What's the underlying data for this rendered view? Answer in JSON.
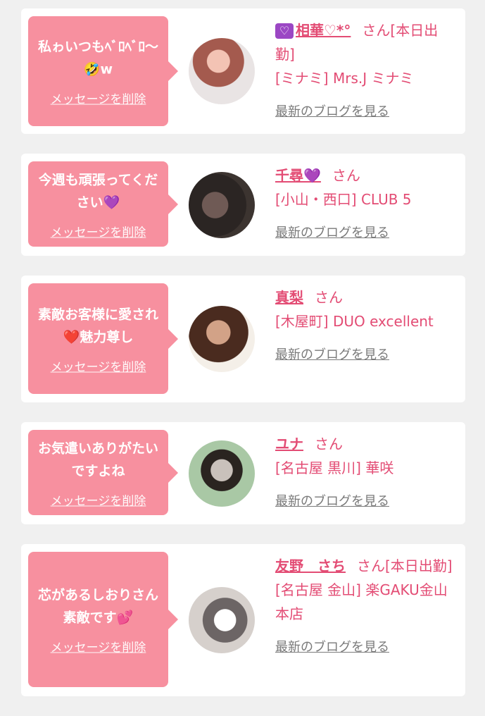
{
  "items": [
    {
      "message": "私ゎいつもﾍﾞﾛﾍﾞﾛ〜🤣w",
      "delete_label": "メッセージを削除",
      "name_prefix_icon": "♡",
      "name": "相華♡*°",
      "suffix": "さん",
      "status": "[本日出勤]",
      "shop": "[ミナミ] Mrs.J ミナミ",
      "blog_label": "最新のブログを見る"
    },
    {
      "message": "今週も頑張ってください💜",
      "delete_label": "メッセージを削除",
      "name": "千尋💜",
      "suffix": "さん",
      "status": "",
      "shop": "[小山・西口] CLUB 5",
      "blog_label": "最新のブログを見る"
    },
    {
      "message": "素敵お客様に愛され❤️魅力尊し",
      "delete_label": "メッセージを削除",
      "name": "真梨",
      "suffix": "さん",
      "status": "",
      "shop": "[木屋町] DUO excellent",
      "blog_label": "最新のブログを見る"
    },
    {
      "message": "お気遣いありがたいですよね",
      "delete_label": "メッセージを削除",
      "name": "ユナ",
      "suffix": "さん",
      "status": "",
      "shop": "[名古屋 黒川] 華咲",
      "blog_label": "最新のブログを見る"
    },
    {
      "message": "芯があるしおりさん素敵です💕",
      "delete_label": "メッセージを削除",
      "name": "友野　さち",
      "suffix": "さん",
      "status": "[本日出勤]",
      "shop": "[名古屋 金山] 楽GAKU金山本店",
      "blog_label": "最新のブログを見る"
    }
  ],
  "colors": {
    "bubble": "#f7909f",
    "accent": "#e34c74",
    "link_gray": "#7a7a7a",
    "background": "#f0f0f0"
  }
}
